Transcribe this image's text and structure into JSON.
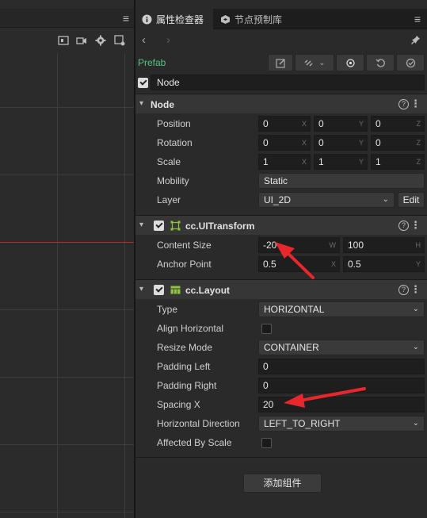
{
  "inspector": {
    "tabs": [
      {
        "label": "属性检查器",
        "icon": "info-icon",
        "active": true
      },
      {
        "label": "节点预制库",
        "icon": "cube-icon",
        "active": false
      }
    ],
    "prefab_label": "Prefab",
    "node_name": "Node",
    "node_section": {
      "title": "Node",
      "position": {
        "label": "Position",
        "x": "0",
        "y": "0",
        "z": "0"
      },
      "rotation": {
        "label": "Rotation",
        "x": "0",
        "y": "0",
        "z": "0"
      },
      "scale": {
        "label": "Scale",
        "x": "1",
        "y": "1",
        "z": "1"
      },
      "mobility": {
        "label": "Mobility",
        "value": "Static"
      },
      "layer": {
        "label": "Layer",
        "value": "UI_2D",
        "edit_label": "Edit"
      },
      "axis": {
        "x": "X",
        "y": "Y",
        "z": "Z",
        "w": "W",
        "h": "H"
      }
    },
    "uitransform": {
      "title": "cc.UITransform",
      "content_size": {
        "label": "Content Size",
        "w": "-20",
        "h": "100"
      },
      "anchor_point": {
        "label": "Anchor Point",
        "x": "0.5",
        "y": "0.5"
      }
    },
    "layout": {
      "title": "cc.Layout",
      "type": {
        "label": "Type",
        "value": "HORIZONTAL"
      },
      "align_horizontal": {
        "label": "Align Horizontal",
        "checked": false
      },
      "resize_mode": {
        "label": "Resize Mode",
        "value": "CONTAINER"
      },
      "padding_left": {
        "label": "Padding Left",
        "value": "0"
      },
      "padding_right": {
        "label": "Padding Right",
        "value": "0"
      },
      "spacing_x": {
        "label": "Spacing X",
        "value": "20"
      },
      "horizontal_direction": {
        "label": "Horizontal Direction",
        "value": "LEFT_TO_RIGHT"
      },
      "affected_by_scale": {
        "label": "Affected By Scale",
        "checked": false
      }
    },
    "add_component_label": "添加组件",
    "help_glyph": "?",
    "kebab_glyph": "⋮",
    "menu_glyph": "≡"
  },
  "colors": {
    "prefab_green": "#4ec97a",
    "annotation_red": "#e8262b",
    "scene_axis_red": "#b52a2a"
  }
}
